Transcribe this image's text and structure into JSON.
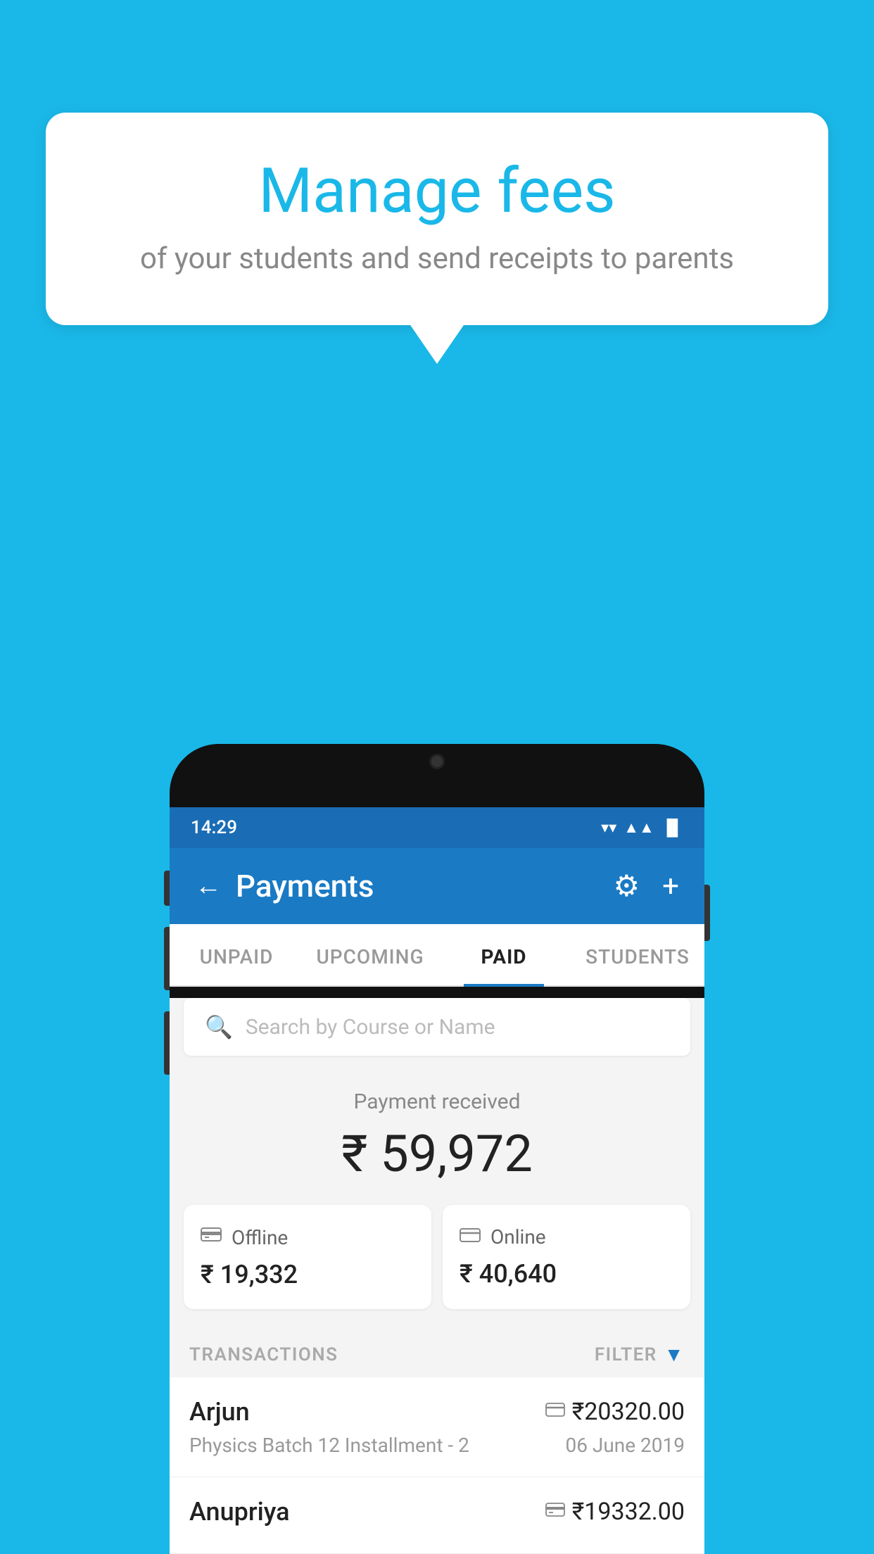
{
  "background_color": "#1ab8e8",
  "bubble": {
    "title": "Manage fees",
    "subtitle": "of your students and send receipts to parents"
  },
  "status_bar": {
    "time": "14:29",
    "wifi": "▼",
    "signal": "▲",
    "battery": "▐"
  },
  "header": {
    "title": "Payments",
    "back_label": "←",
    "gear_label": "⚙",
    "plus_label": "+"
  },
  "tabs": [
    {
      "label": "UNPAID",
      "active": false
    },
    {
      "label": "UPCOMING",
      "active": false
    },
    {
      "label": "PAID",
      "active": true
    },
    {
      "label": "STUDENTS",
      "active": false
    }
  ],
  "search": {
    "placeholder": "Search by Course or Name"
  },
  "payment_received": {
    "label": "Payment received",
    "amount": "₹ 59,972"
  },
  "payment_cards": [
    {
      "icon": "₹",
      "label": "Offline",
      "amount": "₹ 19,332",
      "mode": "offline"
    },
    {
      "icon": "▬",
      "label": "Online",
      "amount": "₹ 40,640",
      "mode": "online"
    }
  ],
  "transactions_label": "TRANSACTIONS",
  "filter_label": "FILTER",
  "transactions": [
    {
      "name": "Arjun",
      "course": "Physics Batch 12 Installment - 2",
      "amount": "₹20320.00",
      "date": "06 June 2019",
      "mode_icon": "▬"
    },
    {
      "name": "Anupriya",
      "course": "",
      "amount": "₹19332.00",
      "date": "",
      "mode_icon": "₹"
    }
  ]
}
